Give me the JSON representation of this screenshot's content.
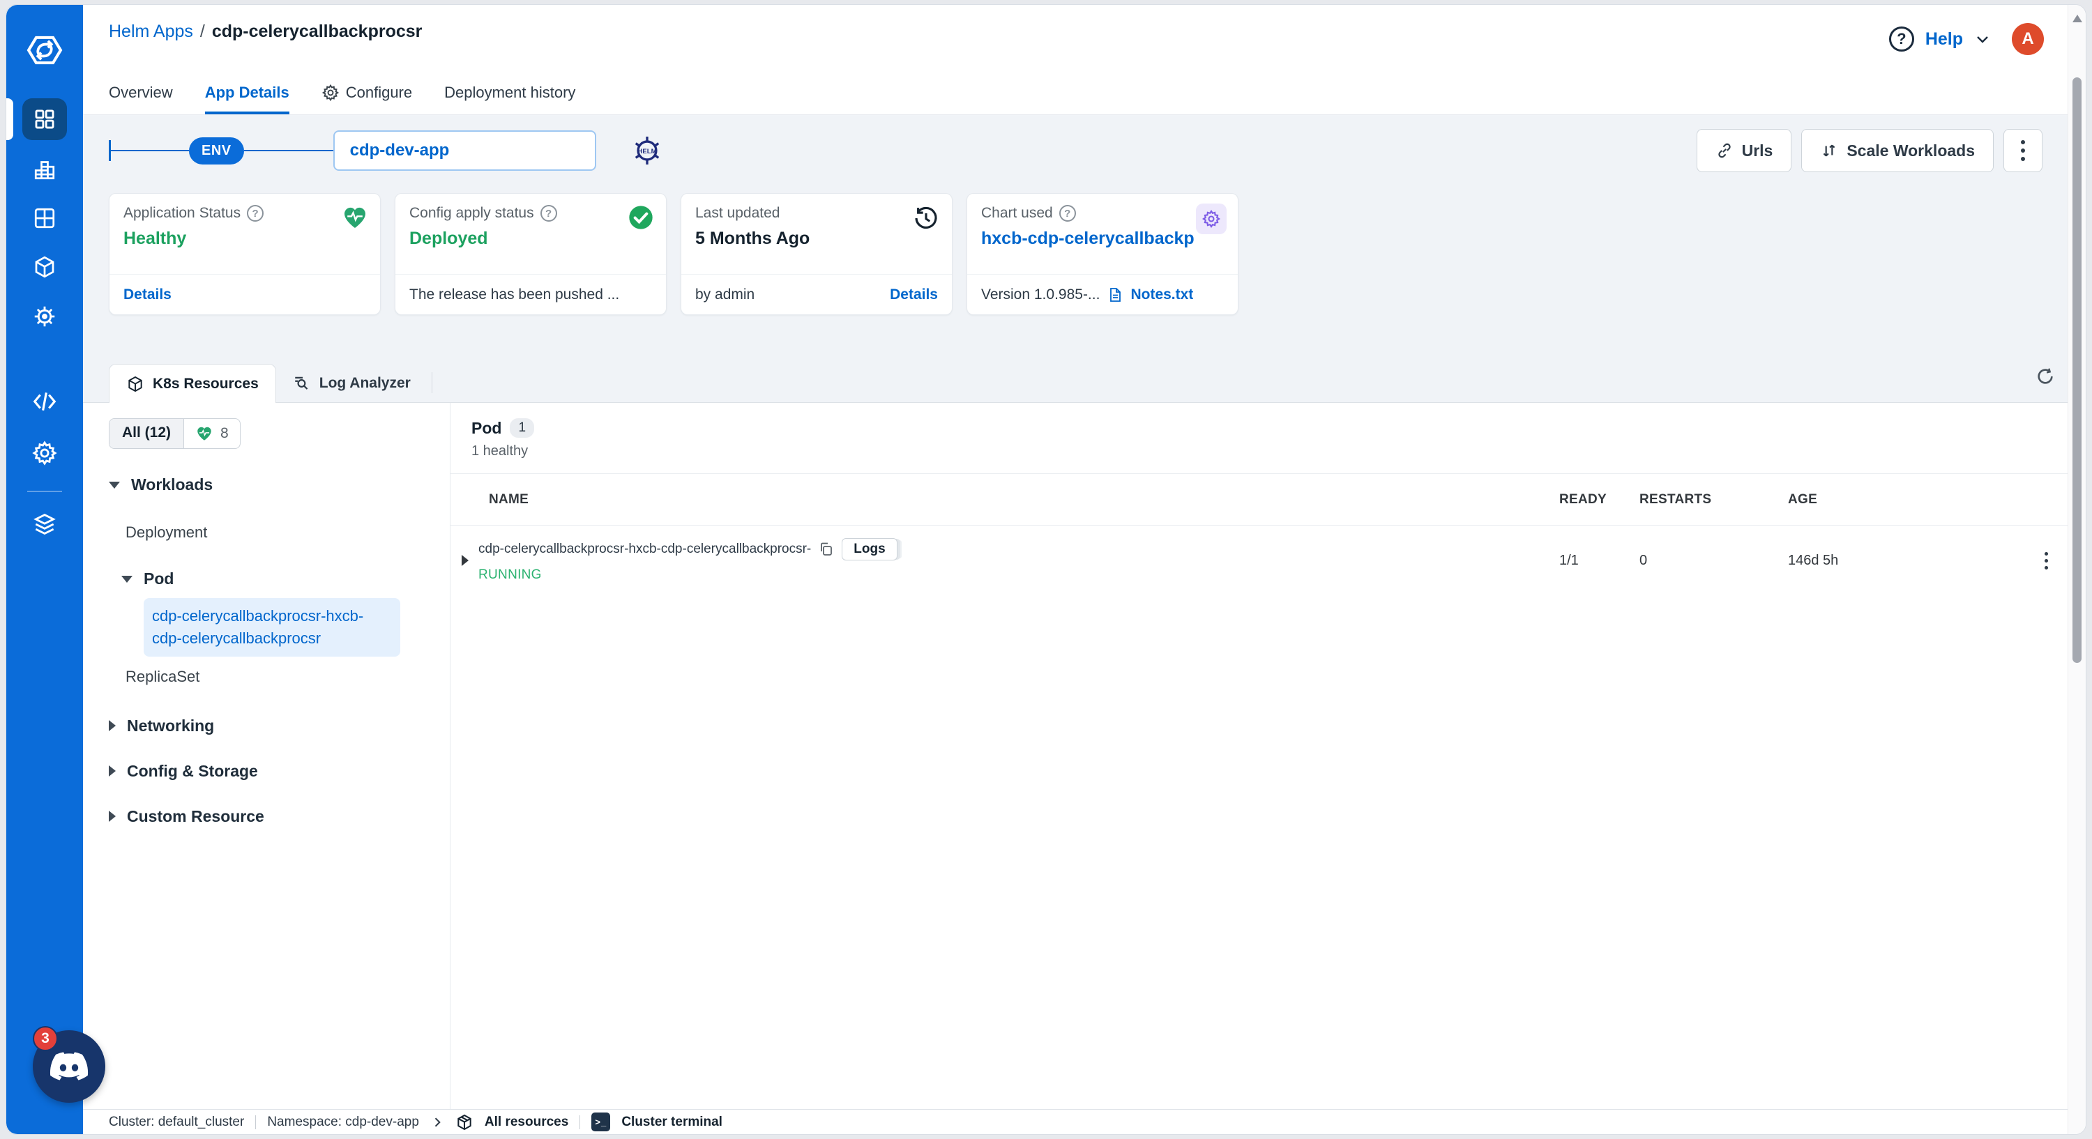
{
  "header": {
    "breadcrumb": {
      "parent": "Helm Apps",
      "separator": "/",
      "current": "cdp-celerycallbackprocsr"
    },
    "help_label": "Help",
    "avatar_initial": "A",
    "tabs": {
      "overview": "Overview",
      "app_details": "App Details",
      "configure": "Configure",
      "deployment_history": "Deployment history"
    }
  },
  "env_bar": {
    "env_badge": "ENV",
    "app_name": "cdp-dev-app",
    "urls_label": "Urls",
    "scale_workloads_label": "Scale Workloads"
  },
  "status_cards": [
    {
      "label": "Application Status",
      "value": "Healthy",
      "footer_link": "Details"
    },
    {
      "label": "Config apply status",
      "value": "Deployed",
      "footer_text": "The release has been pushed ..."
    },
    {
      "label": "Last updated",
      "value": "5 Months Ago",
      "footer_text": "by admin",
      "footer_link": "Details"
    },
    {
      "label": "Chart used",
      "value": "hxcb-cdp-celerycallbackp",
      "footer_text": "Version 1.0.985-...",
      "footer_link": "Notes.txt"
    }
  ],
  "resource_tabs": {
    "k8s_resources": "K8s Resources",
    "log_analyzer": "Log Analyzer"
  },
  "tree": {
    "filter_all": "All (12)",
    "healthy_count": "8",
    "workloads": "Workloads",
    "deployment": "Deployment",
    "pod": "Pod",
    "selected_pod": "cdp-celerycallbackprocsr-hxcb-cdp-celerycallbackprocsr",
    "replicaset": "ReplicaSet",
    "networking": "Networking",
    "config_storage": "Config & Storage",
    "custom_resource": "Custom Resource"
  },
  "pod_table": {
    "title": "Pod",
    "count_badge": "1",
    "subtitle": "1 healthy",
    "columns": [
      "NAME",
      "READY",
      "RESTARTS",
      "AGE"
    ],
    "row": {
      "name": "cdp-celerycallbackprocsr-hxcb-cdp-celerycallbackprocsr-",
      "logs_label": "Logs",
      "status": "RUNNING",
      "ready": "1/1",
      "restarts": "0",
      "age": "146d 5h"
    }
  },
  "footer": {
    "cluster": "Cluster: default_cluster",
    "namespace": "Namespace: cdp-dev-app",
    "all_resources": "All resources",
    "cluster_terminal": "Cluster terminal"
  },
  "discord": {
    "badge_count": "3"
  },
  "colors": {
    "accent_blue": "#0066CC",
    "sidebar_blue": "#0B6CD9",
    "healthy_green": "#1CA15F",
    "running_green": "#2BB270",
    "avatar_orange": "#DE4B2B",
    "badge_red": "#E3403A",
    "chart_gear_purple": "#7C5BE6"
  }
}
